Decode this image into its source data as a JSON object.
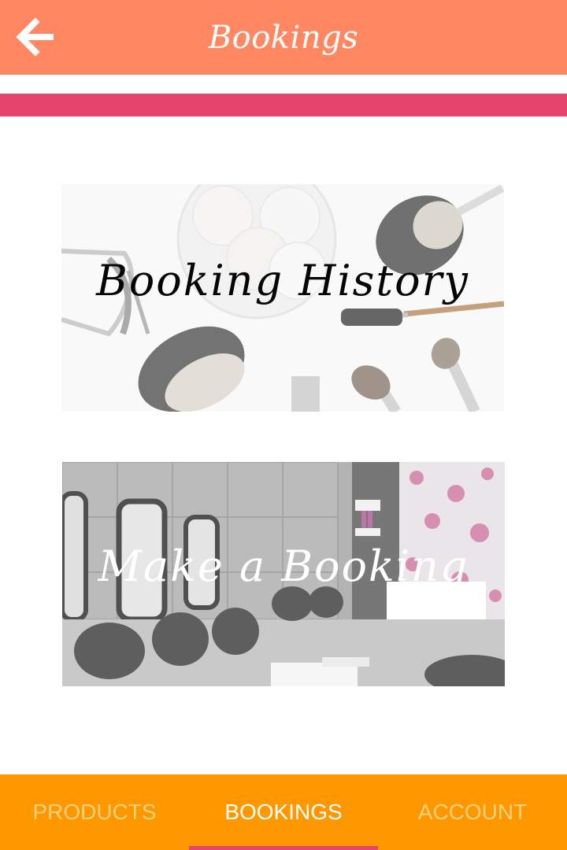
{
  "header": {
    "title": "Bookings",
    "back_icon": "arrow-left-icon",
    "background_color": "#ff8762"
  },
  "accent_color": "#e7446c",
  "cards": [
    {
      "label": "Booking History",
      "image": "makeup-brushes-photo"
    },
    {
      "label": "Make a Booking",
      "image": "hair-salon-interior-photo"
    }
  ],
  "bottom_nav": {
    "background_color": "#ff9800",
    "tabs": [
      {
        "label": "PRODUCTS",
        "active": false
      },
      {
        "label": "BOOKINGS",
        "active": true
      },
      {
        "label": "ACCOUNT",
        "active": false
      }
    ]
  }
}
